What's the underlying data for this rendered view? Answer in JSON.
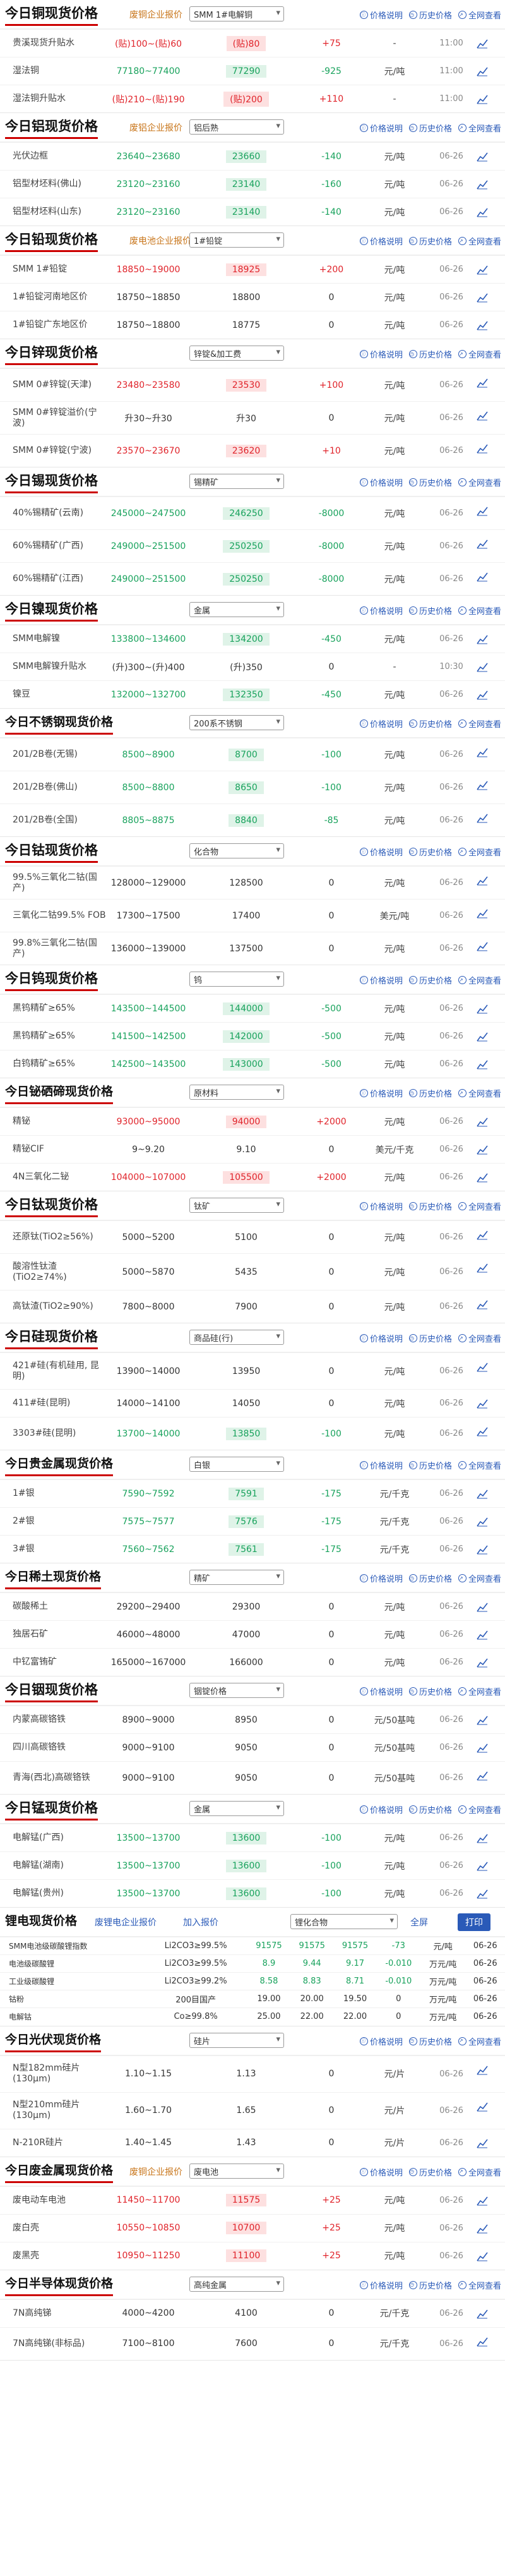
{
  "icons": {
    "desc": "ⓘ",
    "hist": "◷",
    "chart": "↗",
    "explain": "价格说明",
    "history": "历史价格",
    "full": "全网查看"
  },
  "sections": [
    {
      "title": "今日铜现货价格",
      "sub": "废铜企业报价",
      "sel": "SMM 1#电解铜",
      "rows": [
        {
          "n": "贵溪现货升贴水",
          "rg": "(贴)100~(贴)60",
          "av": "(贴)80",
          "ch": "+75",
          "cc": "up",
          "u": "-",
          "d": "11:00"
        },
        {
          "n": "湿法铜",
          "rg": "77180~77400",
          "av": "77290",
          "ch": "-925",
          "cc": "dn",
          "u": "元/吨",
          "d": "11:00"
        },
        {
          "n": "湿法铜升贴水",
          "rg": "(贴)210~(贴)190",
          "av": "(贴)200",
          "ch": "+110",
          "cc": "up",
          "u": "-",
          "d": "11:00"
        }
      ]
    },
    {
      "title": "今日铝现货价格",
      "sub": "废铝企业报价",
      "sel": "铝后熟",
      "rows": [
        {
          "n": "光伏边框",
          "rg": "23640~23680",
          "av": "23660",
          "ch": "-140",
          "cc": "dn",
          "u": "元/吨",
          "d": "06-26"
        },
        {
          "n": "铝型材坯料(佛山)",
          "rg": "23120~23160",
          "av": "23140",
          "ch": "-160",
          "cc": "dn",
          "u": "元/吨",
          "d": "06-26"
        },
        {
          "n": "铝型材坯料(山东)",
          "rg": "23120~23160",
          "av": "23140",
          "ch": "-140",
          "cc": "dn",
          "u": "元/吨",
          "d": "06-26"
        }
      ]
    },
    {
      "title": "今日铅现货价格",
      "sub": "废电池企业报价",
      "sel": "1#铅锭",
      "rows": [
        {
          "n": "SMM 1#铅锭",
          "rg": "18850~19000",
          "av": "18925",
          "ch": "+200",
          "cc": "up",
          "u": "元/吨",
          "d": "06-26"
        },
        {
          "n": "1#铅锭河南地区价",
          "rg": "18750~18850",
          "av": "18800",
          "ch": "0",
          "cc": "flat",
          "u": "元/吨",
          "d": "06-26"
        },
        {
          "n": "1#铅锭广东地区价",
          "rg": "18750~18800",
          "av": "18775",
          "ch": "0",
          "cc": "flat",
          "u": "元/吨",
          "d": "06-26"
        }
      ]
    },
    {
      "title": "今日锌现货价格",
      "sub": "",
      "sel": "锌锭&加工费",
      "rows": [
        {
          "n": "SMM 0#锌锭(天津)",
          "rg": "23480~23580",
          "av": "23530",
          "ch": "+100",
          "cc": "up",
          "u": "元/吨",
          "d": "06-26"
        },
        {
          "n": "SMM 0#锌锭溢价(宁波)",
          "rg": "升30~升30",
          "av": "升30",
          "ch": "0",
          "cc": "flat",
          "u": "元/吨",
          "d": "06-26"
        },
        {
          "n": "SMM 0#锌锭(宁波)",
          "rg": "23570~23670",
          "av": "23620",
          "ch": "+10",
          "cc": "up",
          "u": "元/吨",
          "d": "06-26"
        }
      ]
    },
    {
      "title": "今日锡现货价格",
      "sub": "",
      "sel": "锡精矿",
      "rows": [
        {
          "n": "40%锡精矿(云南)",
          "rg": "245000~247500",
          "av": "246250",
          "ch": "-8000",
          "cc": "dn",
          "u": "元/吨",
          "d": "06-26"
        },
        {
          "n": "60%锡精矿(广西)",
          "rg": "249000~251500",
          "av": "250250",
          "ch": "-8000",
          "cc": "dn",
          "u": "元/吨",
          "d": "06-26"
        },
        {
          "n": "60%锡精矿(江西)",
          "rg": "249000~251500",
          "av": "250250",
          "ch": "-8000",
          "cc": "dn",
          "u": "元/吨",
          "d": "06-26"
        }
      ]
    },
    {
      "title": "今日镍现货价格",
      "sub": "",
      "sel": "金属",
      "rows": [
        {
          "n": "SMM电解镍",
          "rg": "133800~134600",
          "av": "134200",
          "ch": "-450",
          "cc": "dn",
          "u": "元/吨",
          "d": "06-26"
        },
        {
          "n": "SMM电解镍升贴水",
          "rg": "(升)300~(升)400",
          "av": "(升)350",
          "ch": "0",
          "cc": "flat",
          "u": "-",
          "d": "10:30"
        },
        {
          "n": "镍豆",
          "rg": "132000~132700",
          "av": "132350",
          "ch": "-450",
          "cc": "dn",
          "u": "元/吨",
          "d": "06-26"
        }
      ]
    },
    {
      "title": "今日不锈钢现货价格",
      "sub": "",
      "sel": "200系不锈钢",
      "rows": [
        {
          "n": "201/2B卷(无锡)",
          "rg": "8500~8900",
          "av": "8700",
          "ch": "-100",
          "cc": "dn",
          "u": "元/吨",
          "d": "06-26"
        },
        {
          "n": "201/2B卷(佛山)",
          "rg": "8500~8800",
          "av": "8650",
          "ch": "-100",
          "cc": "dn",
          "u": "元/吨",
          "d": "06-26"
        },
        {
          "n": "201/2B卷(全国)",
          "rg": "8805~8875",
          "av": "8840",
          "ch": "-85",
          "cc": "dn",
          "u": "元/吨",
          "d": "06-26"
        }
      ]
    },
    {
      "title": "今日钴现货价格",
      "sub": "",
      "sel": "化合物",
      "rows": [
        {
          "n": "99.5%三氧化二钴(国产)",
          "rg": "128000~129000",
          "av": "128500",
          "ch": "0",
          "cc": "flat",
          "u": "元/吨",
          "d": "06-26"
        },
        {
          "n": "三氧化二钴99.5% FOB",
          "rg": "17300~17500",
          "av": "17400",
          "ch": "0",
          "cc": "flat",
          "u": "美元/吨",
          "d": "06-26"
        },
        {
          "n": "99.8%三氧化二钴(国产)",
          "rg": "136000~139000",
          "av": "137500",
          "ch": "0",
          "cc": "flat",
          "u": "元/吨",
          "d": "06-26"
        }
      ]
    },
    {
      "title": "今日钨现货价格",
      "sub": "",
      "sel": "钨",
      "rows": [
        {
          "n": "黑钨精矿≥65%",
          "rg": "143500~144500",
          "av": "144000",
          "ch": "-500",
          "cc": "dn",
          "u": "元/吨",
          "d": "06-26"
        },
        {
          "n": "黑钨精矿≥65%",
          "rg": "141500~142500",
          "av": "142000",
          "ch": "-500",
          "cc": "dn",
          "u": "元/吨",
          "d": "06-26"
        },
        {
          "n": "白钨精矿≥65%",
          "rg": "142500~143500",
          "av": "143000",
          "ch": "-500",
          "cc": "dn",
          "u": "元/吨",
          "d": "06-26"
        }
      ]
    },
    {
      "title": "今日铋硒碲现货价格",
      "sub": "",
      "sel": "原材料",
      "rows": [
        {
          "n": "精铋",
          "rg": "93000~95000",
          "av": "94000",
          "ch": "+2000",
          "cc": "up",
          "u": "元/吨",
          "d": "06-26"
        },
        {
          "n": "精铋CIF",
          "rg": "9~9.20",
          "av": "9.10",
          "ch": "0",
          "cc": "flat",
          "u": "美元/千克",
          "d": "06-26"
        },
        {
          "n": "4N三氧化二铋",
          "rg": "104000~107000",
          "av": "105500",
          "ch": "+2000",
          "cc": "up",
          "u": "元/吨",
          "d": "06-26"
        }
      ]
    },
    {
      "title": "今日钛现货价格",
      "sub": "",
      "sel": "钛矿",
      "rows": [
        {
          "n": "还原钛(TiO2≥56%)",
          "rg": "5000~5200",
          "av": "5100",
          "ch": "0",
          "cc": "flat",
          "u": "元/吨",
          "d": "06-26"
        },
        {
          "n": "酸溶性钛渣(TiO2≥74%)",
          "rg": "5000~5870",
          "av": "5435",
          "ch": "0",
          "cc": "flat",
          "u": "元/吨",
          "d": "06-26"
        },
        {
          "n": "高钛渣(TiO2≥90%)",
          "rg": "7800~8000",
          "av": "7900",
          "ch": "0",
          "cc": "flat",
          "u": "元/吨",
          "d": "06-26"
        }
      ]
    },
    {
      "title": "今日硅现货价格",
      "sub": "",
      "sel": "商品硅(行)",
      "rows": [
        {
          "n": "421#硅(有机硅用, 昆明)",
          "rg": "13900~14000",
          "av": "13950",
          "ch": "0",
          "cc": "flat",
          "u": "元/吨",
          "d": "06-26"
        },
        {
          "n": "411#硅(昆明)",
          "rg": "14000~14100",
          "av": "14050",
          "ch": "0",
          "cc": "flat",
          "u": "元/吨",
          "d": "06-26"
        },
        {
          "n": "3303#硅(昆明)",
          "rg": "13700~14000",
          "av": "13850",
          "ch": "-100",
          "cc": "dn",
          "u": "元/吨",
          "d": "06-26"
        }
      ]
    },
    {
      "title": "今日贵金属现货价格",
      "sub": "",
      "sel": "白银",
      "rows": [
        {
          "n": "1#银",
          "rg": "7590~7592",
          "av": "7591",
          "ch": "-175",
          "cc": "dn",
          "u": "元/千克",
          "d": "06-26"
        },
        {
          "n": "2#银",
          "rg": "7575~7577",
          "av": "7576",
          "ch": "-175",
          "cc": "dn",
          "u": "元/千克",
          "d": "06-26"
        },
        {
          "n": "3#银",
          "rg": "7560~7562",
          "av": "7561",
          "ch": "-175",
          "cc": "dn",
          "u": "元/千克",
          "d": "06-26"
        }
      ]
    },
    {
      "title": "今日稀土现货价格",
      "sub": "",
      "sel": "精矿",
      "rows": [
        {
          "n": "碳酸稀土",
          "rg": "29200~29400",
          "av": "29300",
          "ch": "0",
          "cc": "flat",
          "u": "元/吨",
          "d": "06-26"
        },
        {
          "n": "独居石矿",
          "rg": "46000~48000",
          "av": "47000",
          "ch": "0",
          "cc": "flat",
          "u": "元/吨",
          "d": "06-26"
        },
        {
          "n": "中钇富铕矿",
          "rg": "165000~167000",
          "av": "166000",
          "ch": "0",
          "cc": "flat",
          "u": "元/吨",
          "d": "06-26"
        }
      ]
    },
    {
      "title": "今日铟现货价格",
      "sub": "",
      "sel": "铟锭价格",
      "rows": [
        {
          "n": "内蒙高碳铬铁",
          "rg": "8900~9000",
          "av": "8950",
          "ch": "0",
          "cc": "flat",
          "u": "元/50基吨",
          "d": "06-26"
        },
        {
          "n": "四川高碳铬铁",
          "rg": "9000~9100",
          "av": "9050",
          "ch": "0",
          "cc": "flat",
          "u": "元/50基吨",
          "d": "06-26"
        },
        {
          "n": "青海(西北)高碳铬铁",
          "rg": "9000~9100",
          "av": "9050",
          "ch": "0",
          "cc": "flat",
          "u": "元/50基吨",
          "d": "06-26"
        }
      ]
    },
    {
      "title": "今日锰现货价格",
      "sub": "",
      "sel": "金属",
      "rows": [
        {
          "n": "电解锰(广西)",
          "rg": "13500~13700",
          "av": "13600",
          "ch": "-100",
          "cc": "dn",
          "u": "元/吨",
          "d": "06-26"
        },
        {
          "n": "电解锰(湖南)",
          "rg": "13500~13700",
          "av": "13600",
          "ch": "-100",
          "cc": "dn",
          "u": "元/吨",
          "d": "06-26"
        },
        {
          "n": "电解锰(贵州)",
          "rg": "13500~13700",
          "av": "13600",
          "ch": "-100",
          "cc": "dn",
          "u": "元/吨",
          "d": "06-26"
        }
      ]
    }
  ],
  "lithium": {
    "title": "锂电现货价格",
    "sub": "废锂电企业报价",
    "add": "加入报价",
    "sel": "锂化合物",
    "full": "全屏",
    "print": "打印",
    "rows": [
      [
        "SMM电池级碳酸锂指数",
        "Li2CO3≥99.5%",
        "91575",
        "91575",
        "91575",
        "-73",
        "元/吨",
        "06-26"
      ],
      [
        "电池级碳酸锂",
        "Li2CO3≥99.5%",
        "8.9",
        "9.44",
        "9.17",
        "-0.010",
        "万元/吨",
        "06-26"
      ],
      [
        "工业级碳酸锂",
        "Li2CO3≥99.2%",
        "8.58",
        "8.83",
        "8.71",
        "-0.010",
        "万元/吨",
        "06-26"
      ],
      [
        "钴粉",
        "200目国产",
        "19.00",
        "20.00",
        "19.50",
        "0",
        "万元/吨",
        "06-26"
      ],
      [
        "电解钴",
        "Co≥99.8%",
        "25.00",
        "22.00",
        "22.00",
        "0",
        "万元/吨",
        "06-26"
      ]
    ]
  },
  "sections2": [
    {
      "title": "今日光伏现货价格",
      "sub": "",
      "sel": "硅片",
      "rows": [
        {
          "n": "N型182mm硅片(130μm)",
          "rg": "1.10~1.15",
          "av": "1.13",
          "ch": "0",
          "cc": "flat",
          "u": "元/片",
          "d": "06-26"
        },
        {
          "n": "N型210mm硅片(130μm)",
          "rg": "1.60~1.70",
          "av": "1.65",
          "ch": "0",
          "cc": "flat",
          "u": "元/片",
          "d": "06-26"
        },
        {
          "n": "N-210R硅片",
          "rg": "1.40~1.45",
          "av": "1.43",
          "ch": "0",
          "cc": "flat",
          "u": "元/片",
          "d": "06-26"
        }
      ]
    },
    {
      "title": "今日废金属现货价格",
      "sub": "废铜企业报价",
      "sel": "废电池",
      "rows": [
        {
          "n": "废电动车电池",
          "rg": "11450~11700",
          "av": "11575",
          "ch": "+25",
          "cc": "up",
          "u": "元/吨",
          "d": "06-26"
        },
        {
          "n": "废白壳",
          "rg": "10550~10850",
          "av": "10700",
          "ch": "+25",
          "cc": "up",
          "u": "元/吨",
          "d": "06-26"
        },
        {
          "n": "废黑壳",
          "rg": "10950~11250",
          "av": "11100",
          "ch": "+25",
          "cc": "up",
          "u": "元/吨",
          "d": "06-26"
        }
      ]
    },
    {
      "title": "今日半导体现货价格",
      "sub": "",
      "sel": "高纯金属",
      "rows": [
        {
          "n": "7N高纯锑",
          "rg": "4000~4200",
          "av": "4100",
          "ch": "0",
          "cc": "flat",
          "u": "元/千克",
          "d": "06-26"
        },
        {
          "n": "7N高纯锑(非标品)",
          "rg": "7100~8100",
          "av": "7600",
          "ch": "0",
          "cc": "flat",
          "u": "元/千克",
          "d": "06-26"
        }
      ]
    }
  ]
}
